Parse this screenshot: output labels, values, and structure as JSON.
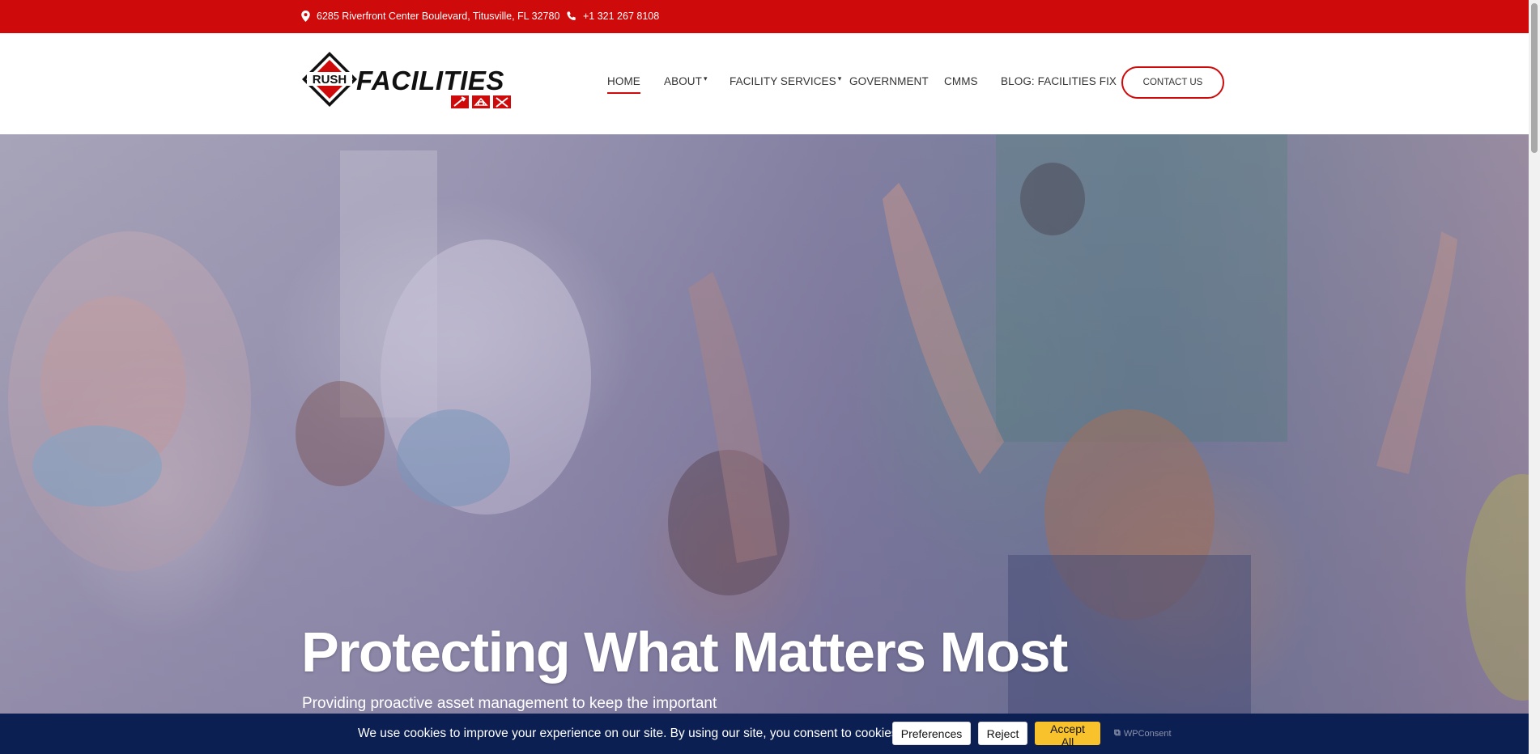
{
  "topbar": {
    "address": "6285 Riverfront Center Boulevard, Titusville, FL 32780",
    "phone": "+1 321 267 8108",
    "icons": [
      "map-pin-icon",
      "phone-icon"
    ],
    "background_color": "#cf0a0a"
  },
  "header": {
    "logo": {
      "badge_text": "RUSH",
      "wordmark": "FACILITIES"
    },
    "nav": [
      {
        "label": "HOME",
        "active": true
      },
      {
        "label": "ABOUT",
        "dropdown": true
      },
      {
        "label": "FACILITY SERVICES",
        "dropdown": true
      },
      {
        "label": "GOVERNMENT"
      },
      {
        "label": "CMMS"
      },
      {
        "label": "BLOG: FACILITIES FIX"
      }
    ],
    "contact_button": "CONTACT US",
    "accent_color": "#cf0a0a"
  },
  "hero": {
    "title": "Protecting What Matters Most",
    "subtitle": "Providing proactive asset management to keep the important"
  },
  "cookie_banner": {
    "message": "We use cookies to improve your experience on our site. By using our site, you consent to cookies.",
    "preferences": "Preferences",
    "reject": "Reject",
    "accept_all": "Accept All",
    "brand": "WPConsent",
    "background_color": "#0b1f52",
    "accept_color": "#f7c22c"
  }
}
